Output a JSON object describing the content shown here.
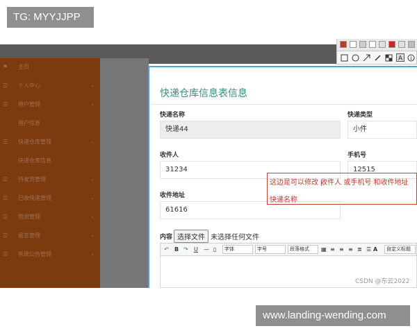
{
  "watermarks": {
    "top_left": "TG: MYYJJPP",
    "bottom_right": "www.landing-wending.com"
  },
  "sidebar": {
    "items": [
      {
        "label": "主页",
        "icon": "flag-icon"
      },
      {
        "label": "个人中心",
        "icon": "list-icon"
      },
      {
        "label": "用户管理",
        "icon": "list-icon"
      },
      {
        "label": "用户信息",
        "icon": ""
      },
      {
        "label": "快递仓库管理",
        "icon": "list-icon"
      },
      {
        "label": "快递仓库信息",
        "icon": ""
      },
      {
        "label": "待发货管理",
        "icon": "list-icon"
      },
      {
        "label": "已收快递管理",
        "icon": "list-icon"
      },
      {
        "label": "物流管理",
        "icon": "list-icon"
      },
      {
        "label": "留言管理",
        "icon": "list-icon"
      },
      {
        "label": "系统公告管理",
        "icon": "list-icon"
      }
    ]
  },
  "form": {
    "title": "快递仓库信息表信息",
    "fields": {
      "name": {
        "label": "快递名称",
        "value": "快递44"
      },
      "type": {
        "label": "快递类型",
        "value": "小件"
      },
      "receiver": {
        "label": "收件人",
        "value": "31234"
      },
      "phone": {
        "label": "手机号",
        "value": "12515"
      },
      "address": {
        "label": "收件地址",
        "value": "61616"
      }
    },
    "content": {
      "label": "内容",
      "button": "选择文件",
      "status": "未选择任何文件"
    }
  },
  "annotation": {
    "line1": "这边是可以修改 收件人 或手机号 和收件地址",
    "line2": "快递名称"
  },
  "editor": {
    "toolbar": {
      "b": "B",
      "i": "I",
      "u": "U",
      "dash": "—",
      "a": "A",
      "font": "字体",
      "size": "字号",
      "paragraph": "段落格式",
      "custom": "自定义标题"
    }
  },
  "credit": "CSDN @东云2022",
  "colors": {
    "sidebar": "#7b3b0f",
    "title": "#3c8d7e",
    "annotation": "#c0392b",
    "accent": "#4aa7c7"
  }
}
